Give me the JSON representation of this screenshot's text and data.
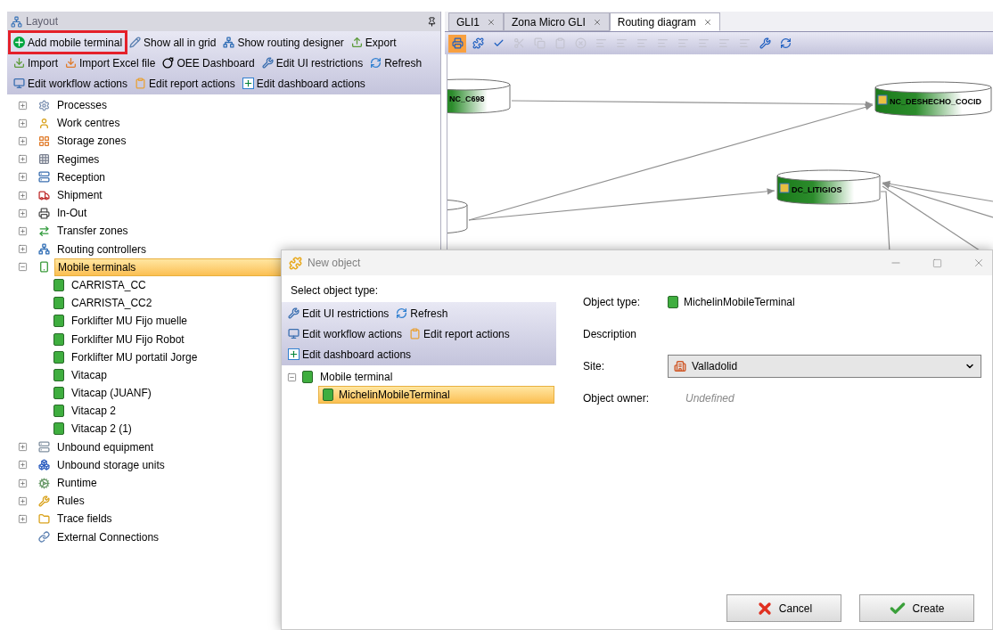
{
  "layout_panel": {
    "title": "Layout",
    "toolbar": [
      {
        "label": "Add mobile terminal",
        "highlighted": true
      },
      {
        "label": "Show all in grid",
        "highlighted": false
      },
      {
        "label": "Show routing designer",
        "highlighted": false
      },
      {
        "label": "Export",
        "highlighted": false
      },
      {
        "label": "Import",
        "highlighted": false
      },
      {
        "label": "Import Excel file",
        "highlighted": false
      },
      {
        "label": "OEE Dashboard",
        "highlighted": false
      },
      {
        "label": "Edit UI restrictions",
        "highlighted": false
      },
      {
        "label": "Refresh",
        "highlighted": false
      },
      {
        "label": "Edit workflow actions",
        "highlighted": false
      },
      {
        "label": "Edit report actions",
        "highlighted": false
      },
      {
        "label": "Edit dashboard actions",
        "highlighted": false
      }
    ],
    "tree": [
      {
        "label": "Processes",
        "expanded": false,
        "selected": false
      },
      {
        "label": "Work centres",
        "expanded": false,
        "selected": false
      },
      {
        "label": "Storage zones",
        "expanded": false,
        "selected": false
      },
      {
        "label": "Regimes",
        "expanded": false,
        "selected": false
      },
      {
        "label": "Reception",
        "expanded": false,
        "selected": false
      },
      {
        "label": "Shipment",
        "expanded": false,
        "selected": false
      },
      {
        "label": "In-Out",
        "expanded": false,
        "selected": false
      },
      {
        "label": "Transfer zones",
        "expanded": false,
        "selected": false
      },
      {
        "label": "Routing controllers",
        "expanded": false,
        "selected": false
      },
      {
        "label": "Mobile terminals",
        "expanded": true,
        "selected": true,
        "children": [
          {
            "label": "CARRISTA_CC",
            "selected": false
          },
          {
            "label": "CARRISTA_CC2",
            "selected": false
          },
          {
            "label": "Forklifter MU Fijo muelle",
            "selected": false
          },
          {
            "label": "Forklifter MU Fijo Robot",
            "selected": false
          },
          {
            "label": "Forklifter MU portatil Jorge",
            "selected": false
          },
          {
            "label": "Vitacap",
            "selected": false
          },
          {
            "label": "Vitacap (JUANF)",
            "selected": false
          },
          {
            "label": "Vitacap 2",
            "selected": false
          },
          {
            "label": "Vitacap 2 (1)",
            "selected": false
          }
        ]
      },
      {
        "label": "Unbound equipment",
        "expanded": false,
        "selected": false
      },
      {
        "label": "Unbound storage units",
        "expanded": false,
        "selected": false
      },
      {
        "label": "Runtime",
        "expanded": false,
        "selected": false
      },
      {
        "label": "Rules",
        "expanded": false,
        "selected": false
      },
      {
        "label": "Trace fields",
        "expanded": false,
        "selected": false
      },
      {
        "label": "External Connections",
        "selected": false
      }
    ]
  },
  "tabs": [
    {
      "label": "GLI1",
      "selected": false
    },
    {
      "label": "Zona Micro GLI",
      "selected": false
    },
    {
      "label": "Routing diagram",
      "selected": true
    }
  ],
  "diagram_toolbar": [
    {
      "selected": true,
      "disabled": false
    },
    {
      "selected": false,
      "disabled": false
    },
    {
      "selected": false,
      "disabled": false
    },
    {
      "selected": false,
      "disabled": true
    },
    {
      "selected": false,
      "disabled": true
    },
    {
      "selected": false,
      "disabled": true
    },
    {
      "selected": false,
      "disabled": true
    },
    {
      "selected": false,
      "disabled": true
    },
    {
      "selected": false,
      "disabled": true
    },
    {
      "selected": false,
      "disabled": true
    },
    {
      "selected": false,
      "disabled": true
    },
    {
      "selected": false,
      "disabled": true
    },
    {
      "selected": false,
      "disabled": true
    },
    {
      "selected": false,
      "disabled": true
    },
    {
      "selected": false,
      "disabled": true
    },
    {
      "selected": false,
      "disabled": false
    },
    {
      "selected": false,
      "disabled": false
    }
  ],
  "diagram": {
    "nodes": [
      {
        "kind": "storage",
        "label": "NC_C698"
      },
      {
        "kind": "storage",
        "label": "NC_DESHECHO_COCID"
      },
      {
        "kind": "storage",
        "label": "DC_LITIGIOS"
      },
      {
        "kind": "storage"
      }
    ]
  },
  "dialog": {
    "title": "New object",
    "select_label": "Select object type:",
    "toolbar": [
      {
        "label": "Edit UI restrictions"
      },
      {
        "label": "Refresh"
      },
      {
        "label": "Edit workflow actions"
      },
      {
        "label": "Edit report actions"
      },
      {
        "label": "Edit dashboard actions"
      }
    ],
    "tree": [
      {
        "label": "Mobile terminal",
        "expanded": true,
        "selected": false,
        "children": [
          {
            "label": "MichelinMobileTerminal",
            "selected": true
          }
        ]
      }
    ],
    "fields": [
      {
        "kind": "icon-text",
        "label": "Object type:",
        "value": "MichelinMobileTerminal"
      },
      {
        "kind": "label",
        "label": "Description"
      },
      {
        "kind": "select",
        "label": "Site:",
        "value": "Valladolid"
      },
      {
        "kind": "placeholder",
        "label": "Object owner:",
        "placeholder": "Undefined"
      }
    ],
    "buttons": [
      {
        "kind": "cancel",
        "label": "Cancel"
      },
      {
        "kind": "create",
        "label": "Create"
      }
    ]
  }
}
